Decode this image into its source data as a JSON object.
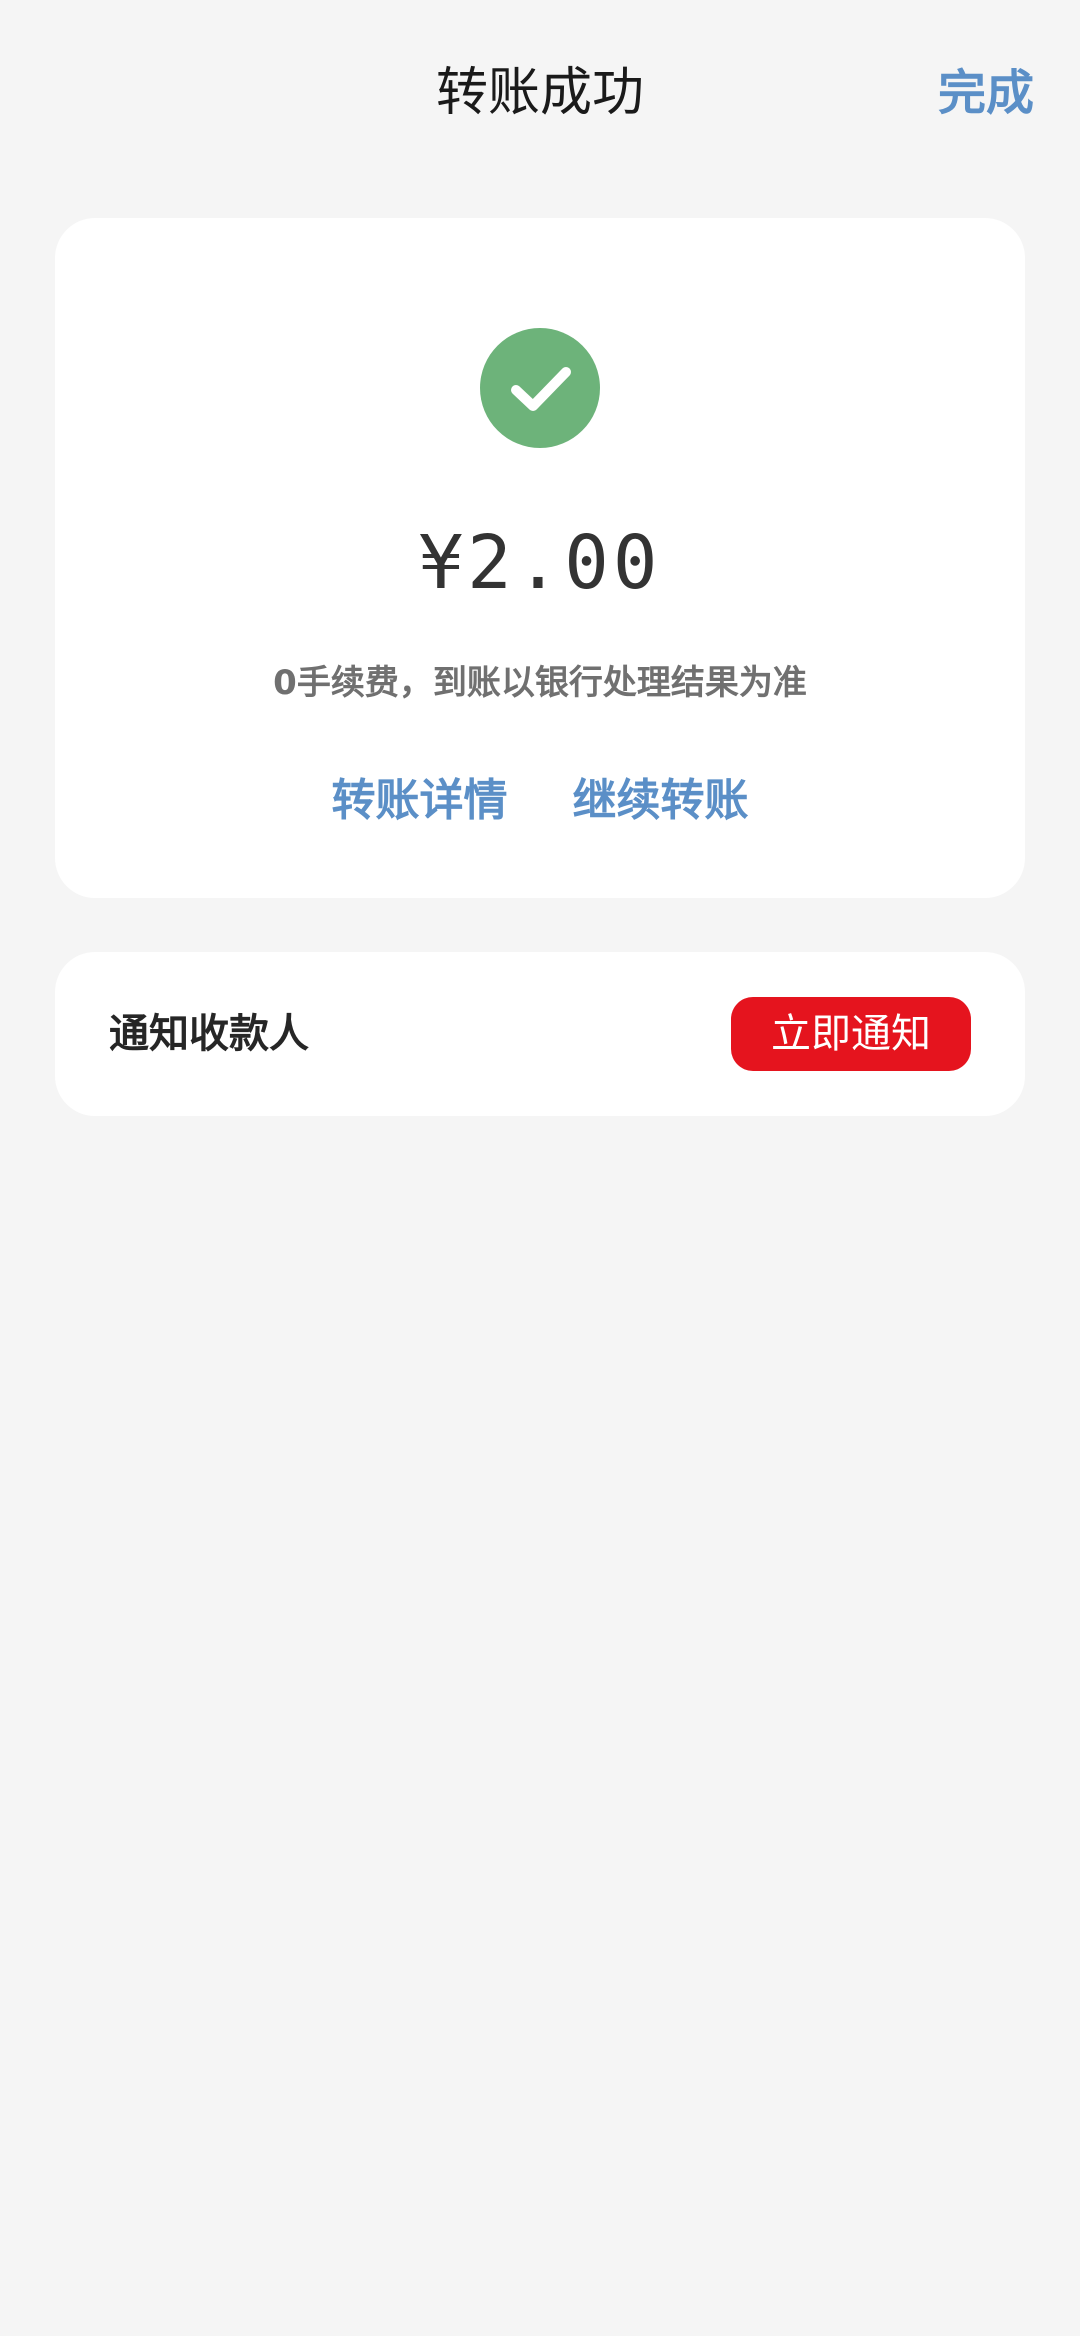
{
  "header": {
    "title": "转账成功",
    "done_label": "完成"
  },
  "result": {
    "status_icon": "check-icon",
    "amount": "¥2.00",
    "fee_note": "0手续费，到账以银行处理结果为准",
    "links": [
      {
        "label": "转账详情"
      },
      {
        "label": "继续转账"
      }
    ]
  },
  "notify": {
    "label": "通知收款人",
    "button_label": "立即通知"
  },
  "colors": {
    "accent": "#5b8fc7",
    "success": "#6db37a",
    "notify_button": "#e5141e",
    "background": "#f5f5f5"
  }
}
